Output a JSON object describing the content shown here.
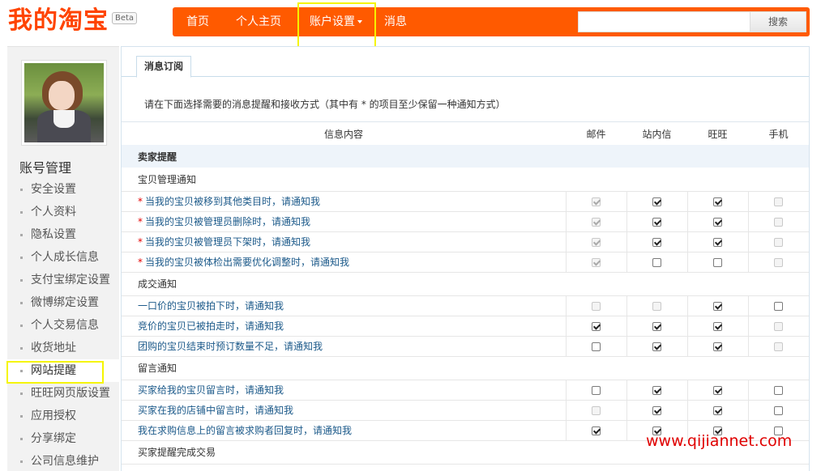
{
  "logo": {
    "text": "我的淘宝",
    "badge": "Beta"
  },
  "nav": {
    "home": "首页",
    "profile": "个人主页",
    "settings": "账户设置",
    "messages": "消息",
    "search_placeholder": "",
    "search_button": "搜索"
  },
  "sidebar": {
    "title": "账号管理",
    "items": [
      {
        "label": "安全设置"
      },
      {
        "label": "个人资料"
      },
      {
        "label": "隐私设置"
      },
      {
        "label": "个人成长信息"
      },
      {
        "label": "支付宝绑定设置"
      },
      {
        "label": "微博绑定设置"
      },
      {
        "label": "个人交易信息"
      },
      {
        "label": "收货地址"
      },
      {
        "label": "网站提醒"
      },
      {
        "label": "旺旺网页版设置"
      },
      {
        "label": "应用授权"
      },
      {
        "label": "分享绑定"
      },
      {
        "label": "公司信息维护"
      }
    ],
    "active_index": 8
  },
  "main": {
    "tab": "消息订阅",
    "intro": "请在下面选择需要的消息提醒和接收方式（其中有 * 的项目至少保留一种通知方式）",
    "columns": {
      "info": "信息内容",
      "mail": "邮件",
      "site": "站内信",
      "wangwang": "旺旺",
      "phone": "手机"
    },
    "section": "卖家提醒",
    "groups": [
      {
        "title": "宝贝管理通知",
        "rows": [
          {
            "text": "当我的宝贝被移到其他类目时，请通知我",
            "required": true,
            "mail": "checked-disabled",
            "site": "checked",
            "wangwang": "checked",
            "phone": "disabled"
          },
          {
            "text": "当我的宝贝被管理员删除时，请通知我",
            "required": true,
            "mail": "checked-disabled",
            "site": "checked",
            "wangwang": "checked",
            "phone": "disabled"
          },
          {
            "text": "当我的宝贝被管理员下架时，请通知我",
            "required": true,
            "mail": "checked-disabled",
            "site": "checked",
            "wangwang": "checked",
            "phone": "disabled"
          },
          {
            "text": "当我的宝贝被体检出需要优化调整时，请通知我",
            "required": true,
            "mail": "checked-disabled",
            "site": "unchecked",
            "wangwang": "unchecked",
            "phone": "disabled"
          }
        ]
      },
      {
        "title": "成交通知",
        "rows": [
          {
            "text": "一口价的宝贝被拍下时，请通知我",
            "required": false,
            "mail": "disabled",
            "site": "disabled",
            "wangwang": "checked",
            "phone": "unchecked"
          },
          {
            "text": "竞价的宝贝已被拍走时，请通知我",
            "required": false,
            "mail": "checked",
            "site": "checked",
            "wangwang": "checked",
            "phone": "disabled"
          },
          {
            "text": "团购的宝贝结束时预订数量不足，请通知我",
            "required": false,
            "mail": "unchecked",
            "site": "checked",
            "wangwang": "checked",
            "phone": "disabled"
          }
        ]
      },
      {
        "title": "留言通知",
        "rows": [
          {
            "text": "买家给我的宝贝留言时，请通知我",
            "required": false,
            "mail": "unchecked",
            "site": "checked",
            "wangwang": "checked",
            "phone": "unchecked"
          },
          {
            "text": "买家在我的店铺中留言时，请通知我",
            "required": false,
            "mail": "disabled",
            "site": "checked",
            "wangwang": "checked",
            "phone": "unchecked"
          },
          {
            "text": "我在求购信息上的留言被求购者回复时，请通知我",
            "required": false,
            "mail": "checked",
            "site": "checked",
            "wangwang": "checked",
            "phone": "unchecked"
          }
        ]
      },
      {
        "title": "买家提醒完成交易",
        "rows": []
      }
    ]
  },
  "watermark": "www.qijiannet.com"
}
